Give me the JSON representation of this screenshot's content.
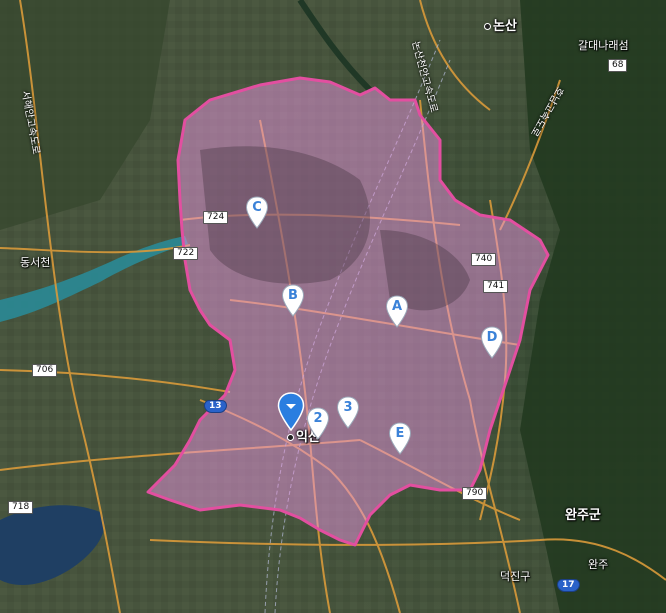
{
  "map": {
    "accent_color": "#e24fa0",
    "region_fill": "rgba(236, 150, 225, 0.5)",
    "marker_color": "#3b82d8",
    "center_marker_color": "#2a7ee0"
  },
  "places": {
    "nonsan": "논산",
    "galdae": "갈대나래섬",
    "dongseo": "동서천",
    "iksan": "익산",
    "wanju": "완주군",
    "wanju2": "완주",
    "deokjin": "덕진구"
  },
  "roads": {
    "r724": "724",
    "r722": "722",
    "r740": "740",
    "r741": "741",
    "r706": "706",
    "r718": "718",
    "r790": "790",
    "r68": "68",
    "r13": "13",
    "r17": "17",
    "nonsan_cheonan": "논산천안고속도로",
    "seohaean": "서해안고속도로",
    "honam": "호남고속도로"
  },
  "markers": [
    {
      "label": "C",
      "icon": "map-pin-icon"
    },
    {
      "label": "B",
      "icon": "map-pin-icon"
    },
    {
      "label": "A",
      "icon": "map-pin-icon"
    },
    {
      "label": "D",
      "icon": "map-pin-icon"
    },
    {
      "label": "2",
      "icon": "map-pin-icon"
    },
    {
      "label": "3",
      "icon": "map-pin-icon"
    },
    {
      "label": "E",
      "icon": "map-pin-icon"
    }
  ],
  "center_marker": {
    "icon": "location-pin-icon"
  }
}
